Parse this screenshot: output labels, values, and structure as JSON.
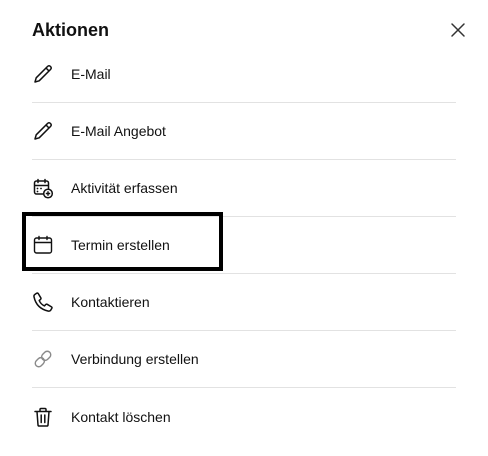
{
  "header": {
    "title": "Aktionen",
    "close_icon": "close-icon"
  },
  "actions": [
    {
      "label": "E-Mail",
      "icon": "pencil-icon"
    },
    {
      "label": "E-Mail Angebot",
      "icon": "pencil-icon"
    },
    {
      "label": "Aktivität erfassen",
      "icon": "calendar-add-icon"
    },
    {
      "label": "Termin erstellen",
      "icon": "calendar-icon",
      "highlighted": true
    },
    {
      "label": "Kontaktieren",
      "icon": "phone-icon"
    },
    {
      "label": "Verbindung erstellen",
      "icon": "link-icon"
    },
    {
      "label": "Kontakt löschen",
      "icon": "trash-icon"
    }
  ],
  "colors": {
    "text": "#111111",
    "divider": "#e2e2e2",
    "highlight_border": "#000000",
    "muted_icon": "#8a8a8a"
  }
}
